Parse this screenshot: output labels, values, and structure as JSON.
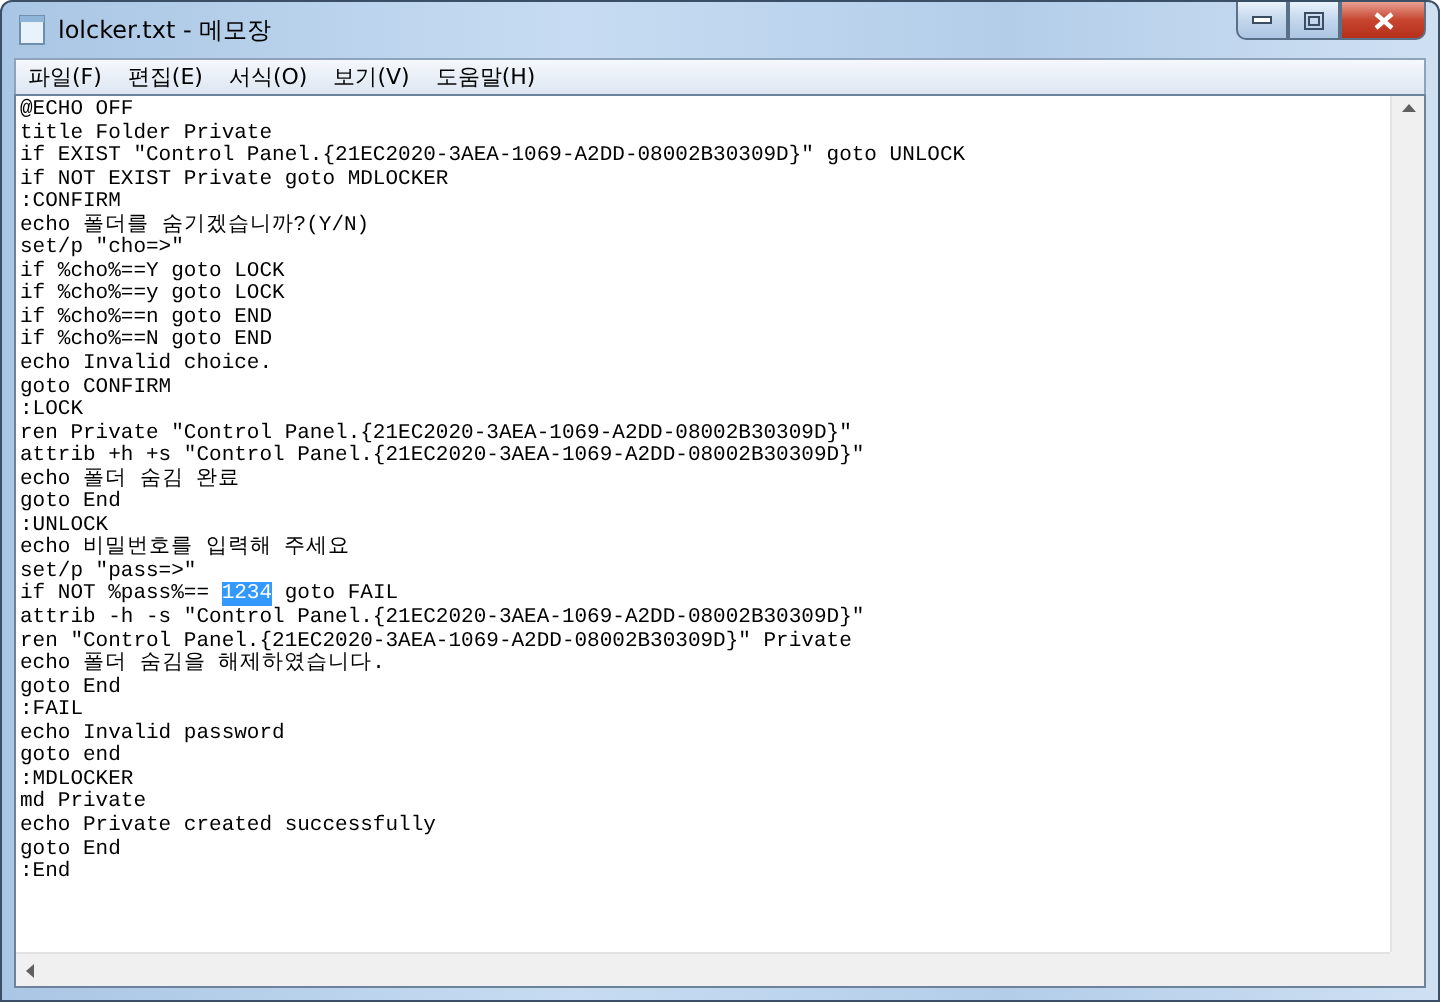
{
  "window": {
    "title": "lolcker.txt - 메모장"
  },
  "menu": [
    "파일(F)",
    "편집(E)",
    "서식(O)",
    "보기(V)",
    "도움말(H)"
  ],
  "lines": [
    {
      "segments": [
        {
          "text": "@ECHO OFF",
          "selected": false
        }
      ]
    },
    {
      "segments": [
        {
          "text": "title Folder Private",
          "selected": false
        }
      ]
    },
    {
      "segments": [
        {
          "text": "if EXIST \"Control Panel.{21EC2020-3AEA-1069-A2DD-08002B30309D}\" goto UNLOCK",
          "selected": false
        }
      ]
    },
    {
      "segments": [
        {
          "text": "if NOT EXIST Private goto MDLOCKER",
          "selected": false
        }
      ]
    },
    {
      "segments": [
        {
          "text": ":CONFIRM",
          "selected": false
        }
      ]
    },
    {
      "segments": [
        {
          "text": "echo 폴더를 숨기겠습니까?(Y/N)",
          "selected": false
        }
      ]
    },
    {
      "segments": [
        {
          "text": "set/p \"cho=>\"",
          "selected": false
        }
      ]
    },
    {
      "segments": [
        {
          "text": "if %cho%==Y goto LOCK",
          "selected": false
        }
      ]
    },
    {
      "segments": [
        {
          "text": "if %cho%==y goto LOCK",
          "selected": false
        }
      ]
    },
    {
      "segments": [
        {
          "text": "if %cho%==n goto END",
          "selected": false
        }
      ]
    },
    {
      "segments": [
        {
          "text": "if %cho%==N goto END",
          "selected": false
        }
      ]
    },
    {
      "segments": [
        {
          "text": "echo Invalid choice.",
          "selected": false
        }
      ]
    },
    {
      "segments": [
        {
          "text": "goto CONFIRM",
          "selected": false
        }
      ]
    },
    {
      "segments": [
        {
          "text": ":LOCK",
          "selected": false
        }
      ]
    },
    {
      "segments": [
        {
          "text": "ren Private \"Control Panel.{21EC2020-3AEA-1069-A2DD-08002B30309D}\"",
          "selected": false
        }
      ]
    },
    {
      "segments": [
        {
          "text": "attrib +h +s \"Control Panel.{21EC2020-3AEA-1069-A2DD-08002B30309D}\"",
          "selected": false
        }
      ]
    },
    {
      "segments": [
        {
          "text": "echo 폴더 숨김 완료",
          "selected": false
        }
      ]
    },
    {
      "segments": [
        {
          "text": "goto End",
          "selected": false
        }
      ]
    },
    {
      "segments": [
        {
          "text": ":UNLOCK",
          "selected": false
        }
      ]
    },
    {
      "segments": [
        {
          "text": "echo 비밀번호를 입력해 주세요",
          "selected": false
        }
      ]
    },
    {
      "segments": [
        {
          "text": "set/p \"pass=>\"",
          "selected": false
        }
      ]
    },
    {
      "segments": [
        {
          "text": "if NOT %pass%== ",
          "selected": false
        },
        {
          "text": "1234",
          "selected": true
        },
        {
          "text": " goto FAIL",
          "selected": false
        }
      ]
    },
    {
      "segments": [
        {
          "text": "attrib -h -s \"Control Panel.{21EC2020-3AEA-1069-A2DD-08002B30309D}\"",
          "selected": false
        }
      ]
    },
    {
      "segments": [
        {
          "text": "ren \"Control Panel.{21EC2020-3AEA-1069-A2DD-08002B30309D}\" Private",
          "selected": false
        }
      ]
    },
    {
      "segments": [
        {
          "text": "echo 폴더 숨김을 해제하였습니다.",
          "selected": false
        }
      ]
    },
    {
      "segments": [
        {
          "text": "goto End",
          "selected": false
        }
      ]
    },
    {
      "segments": [
        {
          "text": ":FAIL",
          "selected": false
        }
      ]
    },
    {
      "segments": [
        {
          "text": "echo Invalid password",
          "selected": false
        }
      ]
    },
    {
      "segments": [
        {
          "text": "goto end",
          "selected": false
        }
      ]
    },
    {
      "segments": [
        {
          "text": ":MDLOCKER",
          "selected": false
        }
      ]
    },
    {
      "segments": [
        {
          "text": "md Private",
          "selected": false
        }
      ]
    },
    {
      "segments": [
        {
          "text": "echo Private created successfully",
          "selected": false
        }
      ]
    },
    {
      "segments": [
        {
          "text": "goto End",
          "selected": false
        }
      ]
    },
    {
      "segments": [
        {
          "text": ":End",
          "selected": false
        }
      ]
    }
  ]
}
